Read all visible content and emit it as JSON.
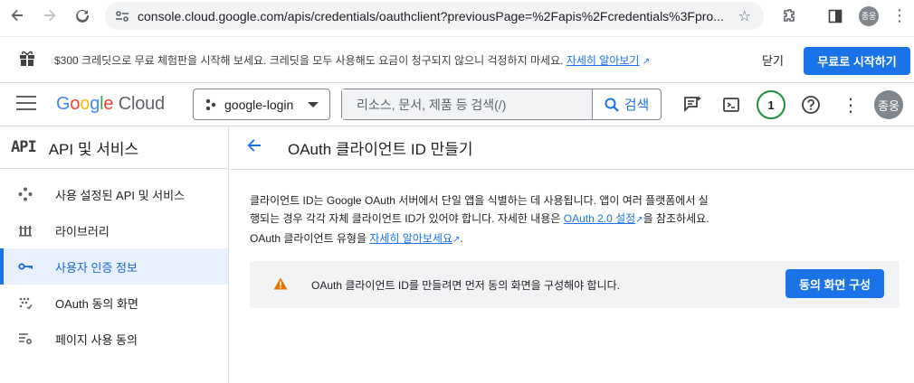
{
  "browser": {
    "url": "console.cloud.google.com/apis/credentials/oauthclient?previousPage=%2Fapis%2Fcredentials%3Fpro..."
  },
  "promo": {
    "text": "$300 크레딧으로 무료 체험판을 시작해 보세요. 크레딧을 모두 사용해도 요금이 청구되지 않으니 걱정하지 마세요.",
    "link": "자세히 알아보기",
    "close_label": "닫기",
    "start_label": "무료로 시작하기"
  },
  "header": {
    "logo_google": "Google",
    "logo_cloud": "Cloud",
    "project": "google-login",
    "search_placeholder": "리소스, 문서, 제품 등 검색(/)",
    "search_button": "검색",
    "notification_count": "1",
    "avatar_text": "종웅"
  },
  "sidebar": {
    "badge": "API",
    "title": "API 및 서비스",
    "items": [
      {
        "label": "사용 설정된 API 및 서비스",
        "icon": "diamond-dots-icon"
      },
      {
        "label": "라이브러리",
        "icon": "library-icon"
      },
      {
        "label": "사용자 인증 정보",
        "icon": "key-icon",
        "active": true
      },
      {
        "label": "OAuth 동의 화면",
        "icon": "consent-icon"
      },
      {
        "label": "페이지 사용 동의",
        "icon": "page-settings-icon"
      }
    ]
  },
  "main": {
    "title": "OAuth 클라이언트 ID 만들기",
    "desc_part1": "클라이언트 ID는 Google OAuth 서버에서 단일 앱을 식별하는 데 사용됩니다. 앱이 여러 플랫폼에서 실행되는 경우 각각 자체 클라이언트 ID가 있어야 합니다. 자세한 내용은 ",
    "desc_link1": "OAuth 2.0 설정",
    "desc_part2": "을 참조하세요. OAuth 클라이언트 유형을 ",
    "desc_link2": "자세히 알아보세요",
    "desc_part3": ".",
    "warning_text": "OAuth 클라이언트 ID를 만들려면 먼저 동의 화면을 구성해야 합니다.",
    "warning_button": "동의 화면 구성"
  },
  "colors": {
    "accent": "#1a73e8",
    "warning": "#e37400",
    "active_bg": "#e8f0fe"
  }
}
